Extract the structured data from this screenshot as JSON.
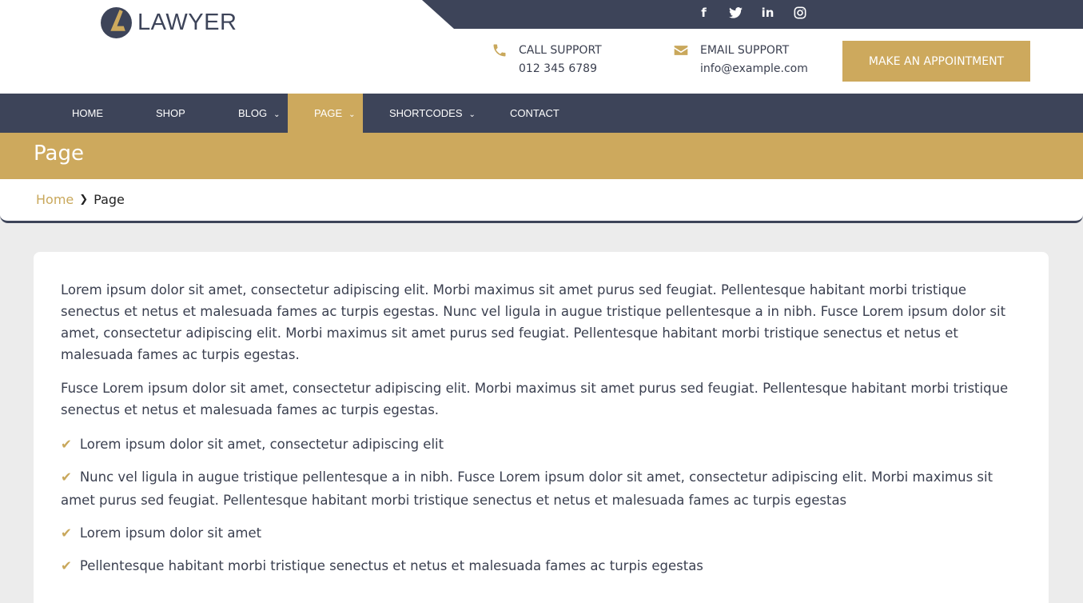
{
  "brand": {
    "name": "LAWYER"
  },
  "social": [
    {
      "icon": "facebook-icon",
      "glyph": "f"
    },
    {
      "icon": "twitter-icon",
      "glyph": "t"
    },
    {
      "icon": "linkedin-icon",
      "glyph": "in"
    },
    {
      "icon": "instagram-icon",
      "glyph": "◎"
    }
  ],
  "support": {
    "call_label": "CALL SUPPORT",
    "call_value": "012 345 6789",
    "email_label": "EMAIL SUPPORT",
    "email_value": "info@example.com"
  },
  "appointment_button": "MAKE AN APPOINTMENT",
  "nav": {
    "home": "HOME",
    "shop": "SHOP",
    "blog": "BLOG",
    "page": "PAGE",
    "shortcodes": "SHORTCODES",
    "contact": "CONTACT"
  },
  "page_title": "Page",
  "breadcrumb": {
    "home": "Home",
    "current": "Page"
  },
  "content": {
    "paragraph_1": "Lorem ipsum dolor sit amet, consectetur adipiscing elit. Morbi maximus sit amet purus sed feugiat. Pellentesque habitant morbi tristique senectus et netus et malesuada fames ac turpis egestas. Nunc vel ligula in augue tristique pellentesque a in nibh. Fusce Lorem ipsum dolor sit amet, consectetur adipiscing elit. Morbi maximus sit amet purus sed feugiat. Pellentesque habitant morbi tristique senectus et netus et malesuada fames ac turpis egestas.",
    "paragraph_2": "Fusce Lorem ipsum dolor sit amet, consectetur adipiscing elit. Morbi maximus sit amet purus sed feugiat. Pellentesque habitant morbi tristique senectus et netus et malesuada fames ac turpis egestas.",
    "list": [
      "Lorem ipsum dolor sit amet, consectetur adipiscing elit",
      "Nunc vel ligula in augue tristique pellentesque a in nibh. Fusce Lorem ipsum dolor sit amet, consectetur adipiscing elit. Morbi maximus sit amet purus sed feugiat. Pellentesque habitant morbi tristique senectus et netus et malesuada fames ac turpis egestas",
      "Lorem ipsum dolor sit amet",
      "Pellentesque habitant morbi tristique senectus et netus et malesuada fames ac turpis egestas"
    ]
  },
  "colors": {
    "navy": "#3d4459",
    "gold": "#cda95d",
    "background": "#ececec"
  }
}
